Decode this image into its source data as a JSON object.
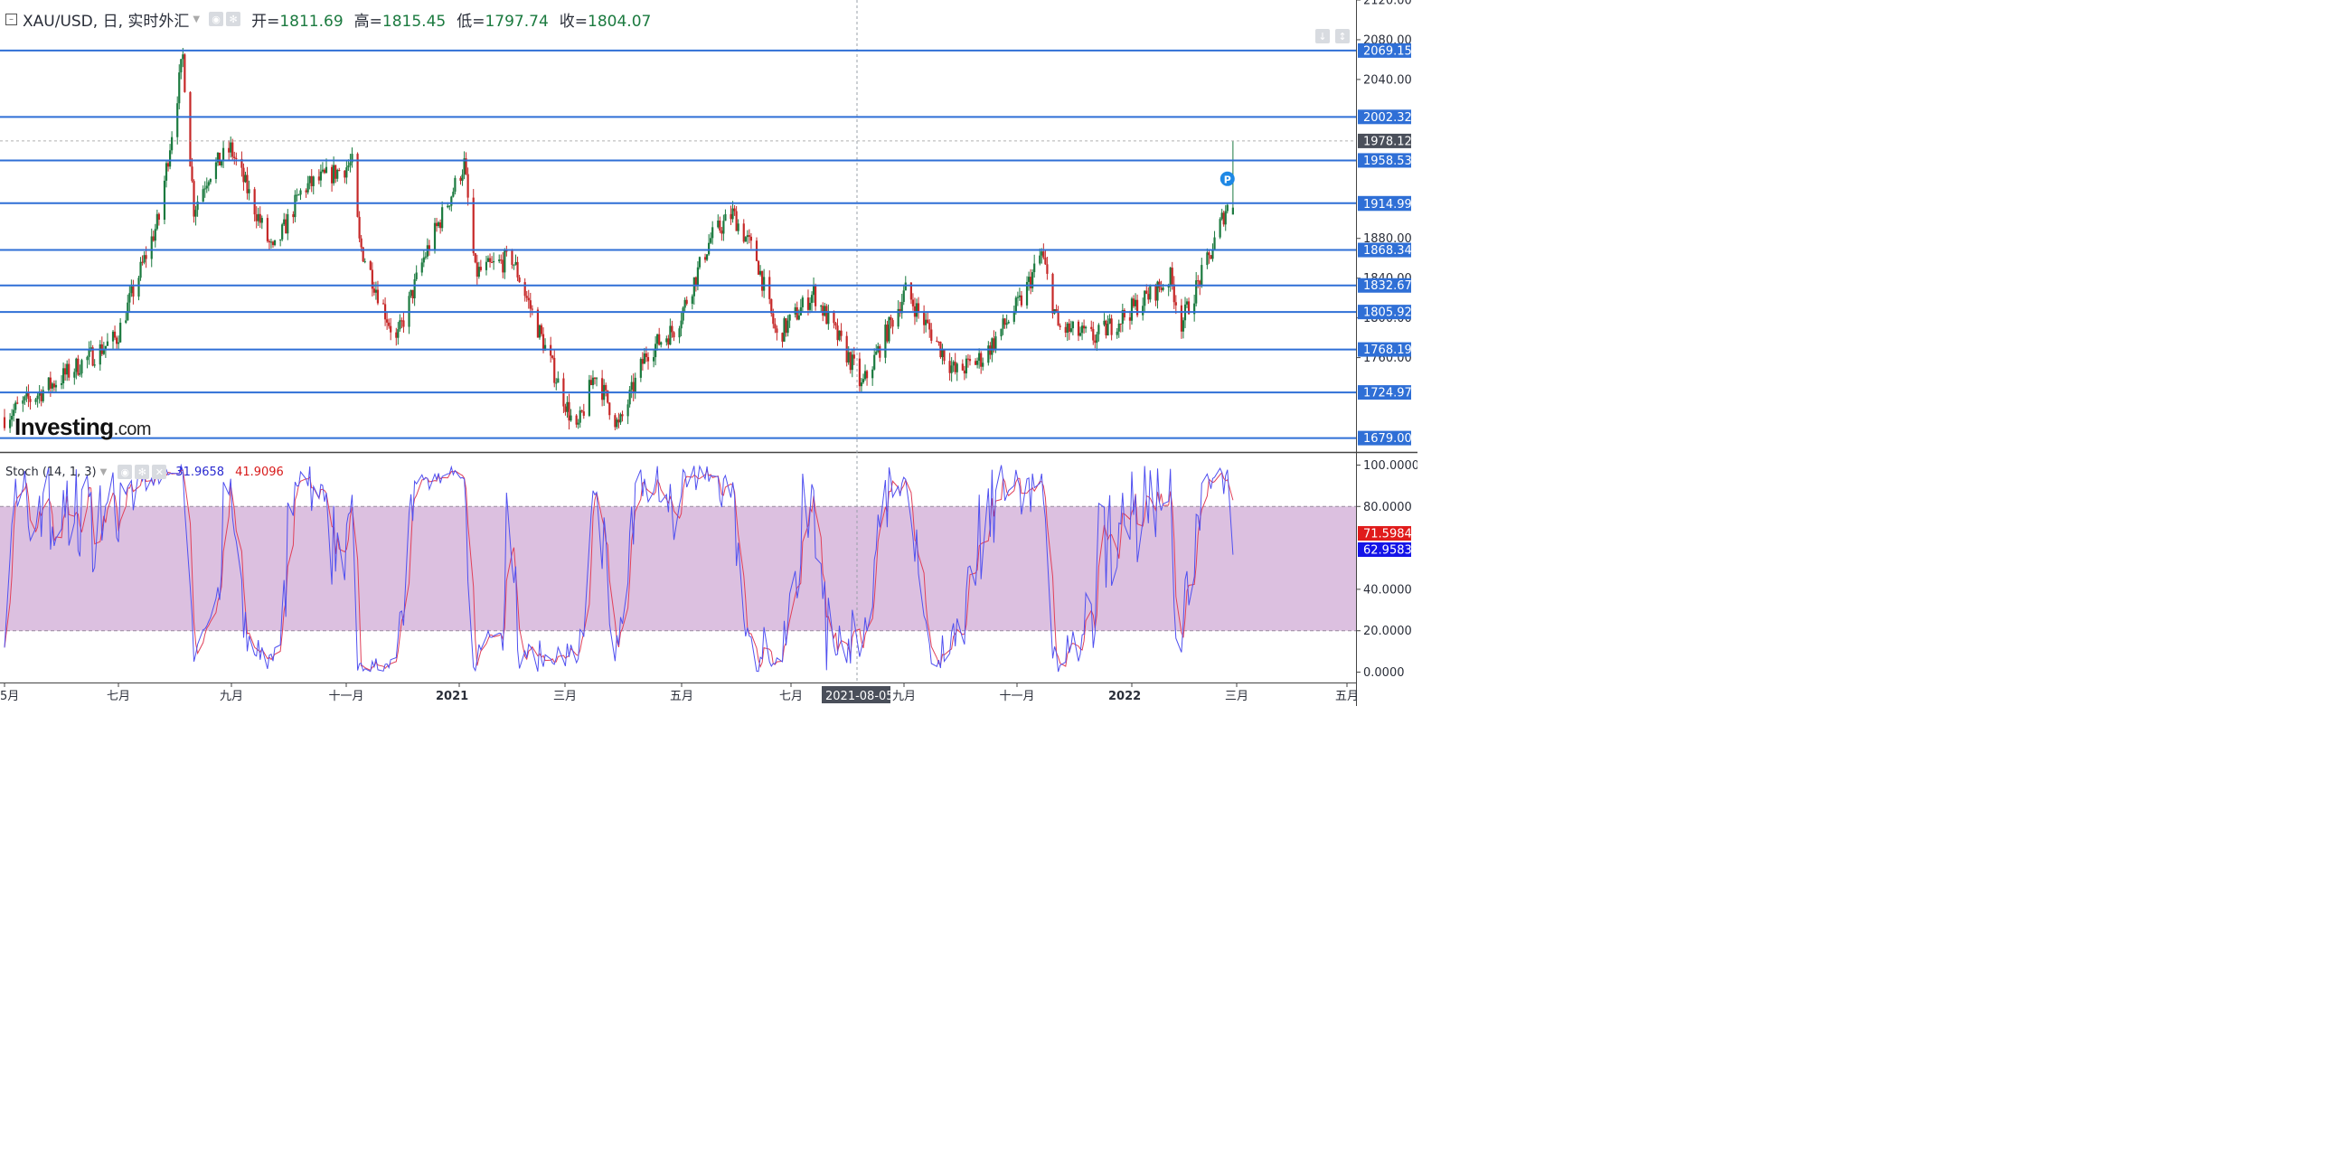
{
  "header": {
    "symbol": "XAU/USD, 日, 实时外汇",
    "open_label": "开=",
    "open": "1811.69",
    "high_label": "高=",
    "high": "1815.45",
    "low_label": "低=",
    "low": "1797.74",
    "close_label": "收=",
    "close": "1804.07"
  },
  "stoch_header": {
    "title": "Stoch (14, 1, 3)",
    "k": "31.9658",
    "d": "41.9096"
  },
  "logo": {
    "main": "Investing",
    "suffix": ".com"
  },
  "colors": {
    "up": "#1b7a3f",
    "down": "#c62828",
    "hline": "#2f6fd6",
    "k_line": "#5050f0",
    "d_line": "#e0405a",
    "stoch_band": "#dcc0e0"
  },
  "chart_data": [
    {
      "type": "candlestick",
      "title": "XAU/USD, 日, 实时外汇",
      "ylim": [
        1665,
        2120
      ],
      "y_ticks": [
        "2120.00",
        "2080.00",
        "2040.00",
        "1880.00",
        "1840.00",
        "1800.00",
        "1760.00"
      ],
      "x_tick_labels": [
        "5月",
        "七月",
        "九月",
        "十一月",
        "2021",
        "三月",
        "五月",
        "七月",
        "九月",
        "十一月",
        "2022",
        "三月",
        "五月"
      ],
      "crosshair_date": "2021-08-05",
      "last_price_label": "1978.12",
      "horizontal_levels": [
        "2069.15",
        "2002.32",
        "1958.53",
        "1915.43",
        "1868.34",
        "1832.67",
        "1805.92",
        "1768.19",
        "1724.97",
        "1679.00"
      ],
      "price_labels": [
        "1914.99"
      ],
      "marker_label": "P",
      "approx_close_path": [
        {
          "d": "2020-05-01",
          "c": 1700
        },
        {
          "d": "2020-06-01",
          "c": 1740
        },
        {
          "d": "2020-07-01",
          "c": 1780
        },
        {
          "d": "2020-07-24",
          "c": 1900
        },
        {
          "d": "2020-08-06",
          "c": 2063
        },
        {
          "d": "2020-08-12",
          "c": 1910
        },
        {
          "d": "2020-08-20",
          "c": 1945
        },
        {
          "d": "2020-09-01",
          "c": 1970
        },
        {
          "d": "2020-09-24",
          "c": 1865
        },
        {
          "d": "2020-10-10",
          "c": 1930
        },
        {
          "d": "2020-11-06",
          "c": 1955
        },
        {
          "d": "2020-11-10",
          "c": 1875
        },
        {
          "d": "2020-11-30",
          "c": 1776
        },
        {
          "d": "2020-12-15",
          "c": 1860
        },
        {
          "d": "2021-01-06",
          "c": 1955
        },
        {
          "d": "2021-01-12",
          "c": 1845
        },
        {
          "d": "2021-02-01",
          "c": 1860
        },
        {
          "d": "2021-02-18",
          "c": 1775
        },
        {
          "d": "2021-03-08",
          "c": 1684
        },
        {
          "d": "2021-03-18",
          "c": 1745
        },
        {
          "d": "2021-03-31",
          "c": 1690
        },
        {
          "d": "2021-04-15",
          "c": 1765
        },
        {
          "d": "2021-05-01",
          "c": 1790
        },
        {
          "d": "2021-05-20",
          "c": 1880
        },
        {
          "d": "2021-06-01",
          "c": 1905
        },
        {
          "d": "2021-06-14",
          "c": 1860
        },
        {
          "d": "2021-06-25",
          "c": 1780
        },
        {
          "d": "2021-07-15",
          "c": 1825
        },
        {
          "d": "2021-08-06",
          "c": 1750
        },
        {
          "d": "2021-08-10",
          "c": 1730
        },
        {
          "d": "2021-09-03",
          "c": 1827
        },
        {
          "d": "2021-09-30",
          "c": 1745
        },
        {
          "d": "2021-10-15",
          "c": 1760
        },
        {
          "d": "2021-11-05",
          "c": 1818
        },
        {
          "d": "2021-11-16",
          "c": 1865
        },
        {
          "d": "2021-11-25",
          "c": 1790
        },
        {
          "d": "2021-12-15",
          "c": 1780
        },
        {
          "d": "2022-01-05",
          "c": 1810
        },
        {
          "d": "2022-01-25",
          "c": 1840
        },
        {
          "d": "2022-01-31",
          "c": 1795
        },
        {
          "d": "2022-02-15",
          "c": 1860
        },
        {
          "d": "2022-02-24",
          "c": 1910
        },
        {
          "d": "2022-03-01",
          "c": 1915
        }
      ]
    },
    {
      "type": "line",
      "title": "Stoch (14, 1, 3)",
      "ylim": [
        -5,
        105
      ],
      "y_ticks": [
        "100.0000",
        "80.0000",
        "40.0000",
        "20.0000",
        "0.0000"
      ],
      "band": [
        20,
        80
      ],
      "last_values": [
        "71.5984",
        "62.9583"
      ],
      "series": [
        {
          "name": "31.9658",
          "values": []
        },
        {
          "name": "41.9096",
          "values": []
        }
      ]
    }
  ]
}
